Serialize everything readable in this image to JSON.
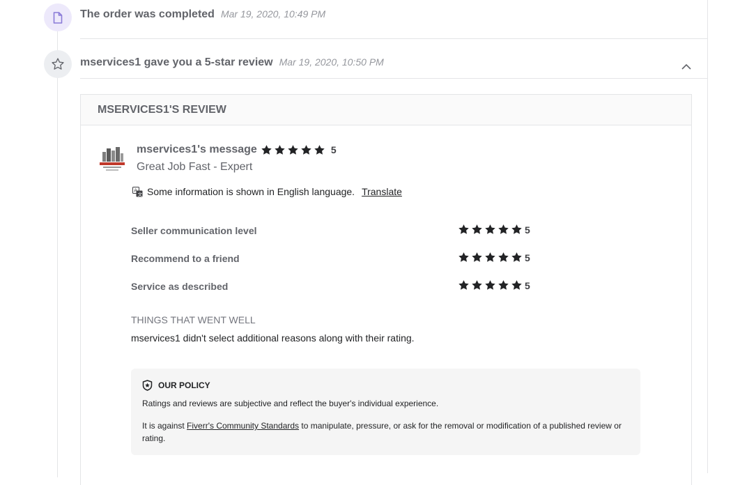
{
  "events": [
    {
      "title": "The order was completed",
      "time": "Mar 19, 2020, 10:49 PM",
      "icon": "document-icon"
    },
    {
      "title": "mservices1 gave you a 5-star review",
      "time": "Mar 19, 2020, 10:50 PM",
      "icon": "star-outline-icon"
    }
  ],
  "review": {
    "header": "mservices1's Review",
    "author_label": "mservices1's message",
    "overall_rating": "5",
    "message": "Great Job Fast - Expert",
    "language_notice": "Some information is shown in English language.",
    "translate_label": "Translate",
    "ratings": [
      {
        "label": "Seller communication level",
        "score": "5"
      },
      {
        "label": "Recommend to a friend",
        "score": "5"
      },
      {
        "label": "Service as described",
        "score": "5"
      }
    ],
    "went_well_title": "Things that went well",
    "went_well_text": "mservices1 didn't select additional reasons along with their rating."
  },
  "policy": {
    "title": "OUR POLICY",
    "p1": "Ratings and reviews are subjective and reflect the buyer's individual experience.",
    "p2_before": "It is against ",
    "p2_link": "Fiverr's Community Standards",
    "p2_after": " to manipulate, pressure, or ask for the removal or modification of a published review or rating."
  },
  "colors": {
    "order_icon_bg": "#ede9fb",
    "order_icon": "#8a7bd8",
    "review_icon_bg": "#eceef1",
    "star_fill": "#222325"
  }
}
